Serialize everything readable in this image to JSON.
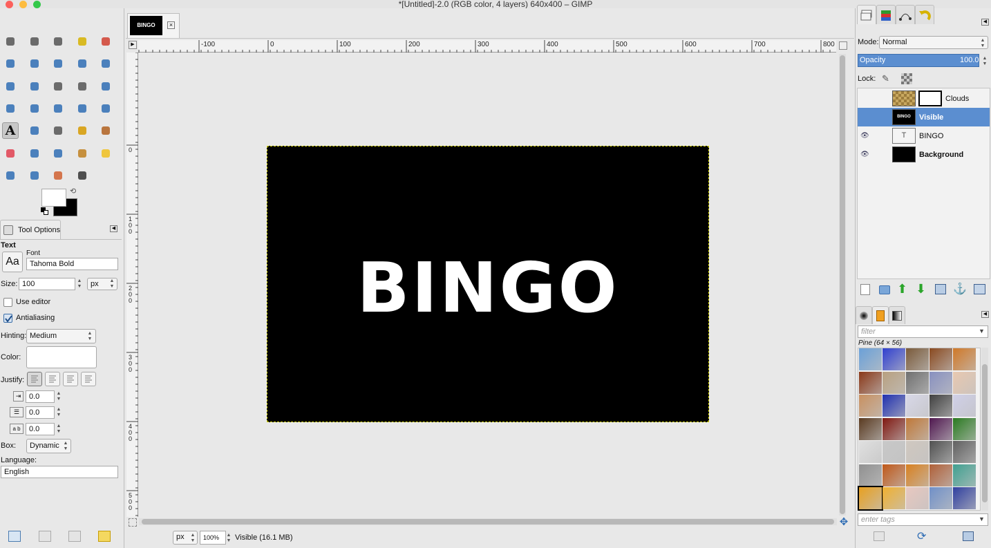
{
  "window": {
    "title": "*[Untitled]-2.0 (RGB color, 4 layers) 640x400 – GIMP"
  },
  "image_tab": {
    "thumb_text": "BINGO"
  },
  "canvas": {
    "text": "BINGO"
  },
  "hruler_labels": [
    "-100",
    "0",
    "100",
    "200",
    "300",
    "400",
    "500",
    "600",
    "700",
    "800"
  ],
  "vruler_labels": [
    "0",
    "1\n0\n0",
    "2\n0\n0",
    "3\n0\n0",
    "4\n0\n0",
    "5\n0\n0"
  ],
  "tool_options": {
    "tab_label": "Tool Options",
    "section": "Text",
    "font_label": "Font",
    "font_value": "Tahoma Bold",
    "font_icon_text": "Aa",
    "size_label": "Size:",
    "size_value": "100",
    "size_unit": "px",
    "use_editor_label": "Use editor",
    "use_editor_checked": false,
    "antialiasing_label": "Antialiasing",
    "antialiasing_checked": true,
    "hinting_label": "Hinting:",
    "hinting_value": "Medium",
    "color_label": "Color:",
    "color_value": "#ffffff",
    "justify_label": "Justify:",
    "indent_value": "0.0",
    "line_spacing_value": "0.0",
    "letter_spacing_value": "0.0",
    "letter_spacing_icon_text": "a b",
    "box_label": "Box:",
    "box_value": "Dynamic",
    "language_label": "Language:",
    "language_value": "English"
  },
  "statusbar": {
    "unit": "px",
    "zoom": "100%",
    "message": "Visible (16.1 MB)"
  },
  "layers_panel": {
    "mode_label": "Mode:",
    "mode_value": "Normal",
    "opacity_label": "Opacity",
    "opacity_value": "100.0",
    "lock_label": "Lock:",
    "layers": [
      {
        "name": "Clouds",
        "visible": false,
        "selected": false,
        "bold": false
      },
      {
        "name": "Visible",
        "visible": false,
        "selected": true,
        "bold": true
      },
      {
        "name": "BINGO",
        "visible": true,
        "selected": false,
        "bold": false
      },
      {
        "name": "Background",
        "visible": true,
        "selected": false,
        "bold": true
      }
    ],
    "visible_thumb_text": "BINGO"
  },
  "patterns_panel": {
    "filter_placeholder": "filter",
    "selected_pattern": "Pine (64 × 56)",
    "tags_placeholder": "enter tags"
  },
  "colors": {
    "foreground": "#ffffff",
    "background": "#000000",
    "accent": "#5b8ed0"
  }
}
